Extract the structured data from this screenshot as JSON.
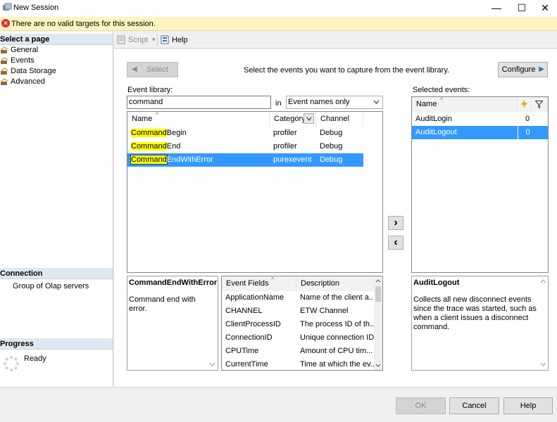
{
  "window": {
    "title": "New Session",
    "minimize": "—",
    "maximize": "☐",
    "close": "✕"
  },
  "warning": {
    "message": "There are no valid targets for this session."
  },
  "nav": {
    "select_page": "Select a page",
    "pages": [
      "General",
      "Events",
      "Data Storage",
      "Advanced"
    ],
    "connection_header": "Connection",
    "connection_value": "Group of Olap servers",
    "progress_header": "Progress",
    "progress_status": "Ready"
  },
  "toolbar": {
    "script_label": "Script",
    "script_arrow": "▾",
    "help_label": "Help"
  },
  "events": {
    "select_button": "Select",
    "instruction": "Select the events you want to capture from the event library.",
    "configure_button": "Configure",
    "library_label": "Event library:",
    "search_value": "command",
    "in_label": "in",
    "scope_value": "Event names only",
    "library_columns": [
      "Name",
      "Category",
      "Channel"
    ],
    "library_rows": [
      {
        "match": "Command",
        "rest": "Begin",
        "category": "profiler",
        "channel": "Debug"
      },
      {
        "match": "Command",
        "rest": "End",
        "category": "profiler",
        "channel": "Debug"
      },
      {
        "match": "Command",
        "rest": "EndWithError",
        "category": "purexevent",
        "channel": "Debug"
      }
    ],
    "selected_label": "Selected events:",
    "selected_columns": [
      "Name"
    ],
    "selected_rows": [
      {
        "name": "AuditLogin",
        "count": "0"
      },
      {
        "name": "AuditLogout",
        "count": "0"
      }
    ],
    "add_arrow": "›",
    "remove_arrow": "‹",
    "detail_title": "CommandEndWithError",
    "detail_desc": "Command end with error.",
    "fields_columns": [
      "Event Fields",
      "Description"
    ],
    "fields_rows": [
      {
        "field": "ApplicationName",
        "desc": "Name of the client a..."
      },
      {
        "field": "CHANNEL",
        "desc": "ETW Channel"
      },
      {
        "field": "ClientProcessID",
        "desc": "The process ID of th..."
      },
      {
        "field": "ConnectionID",
        "desc": "Unique connection ID."
      },
      {
        "field": "CPUTime",
        "desc": "Amount of CPU tim..."
      },
      {
        "field": "CurrentTime",
        "desc": "Time at which the ev..."
      }
    ],
    "selected_detail_title": "AuditLogout",
    "selected_detail_desc": "Collects all new disconnect events since the trace was started, such as when a client issues a disconnect command."
  },
  "footer": {
    "ok": "OK",
    "cancel": "Cancel",
    "help": "Help"
  },
  "colors": {
    "selection": "#3399ff",
    "highlight": "#ffff00",
    "warning_bg": "#fdf4bf",
    "error": "#d9302c"
  }
}
